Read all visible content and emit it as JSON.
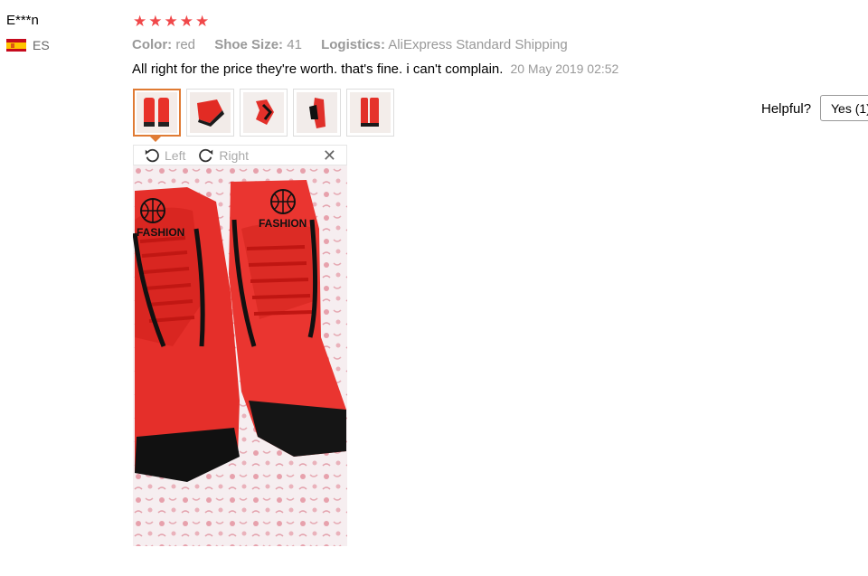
{
  "reviewer": {
    "name": "E***n",
    "country_code": "ES",
    "flag_icon": "spain-flag-icon"
  },
  "rating": {
    "stars": 5,
    "max": 5,
    "star_color": "#f0484a"
  },
  "attributes": [
    {
      "key": "Color:",
      "value": "red"
    },
    {
      "key": "Shoe Size:",
      "value": "41"
    },
    {
      "key": "Logistics:",
      "value": "AliExpress Standard Shipping"
    }
  ],
  "feedback": {
    "text": "All right for the price they're worth. that's fine. i can't complain.",
    "date": "20 May 2019 02:52"
  },
  "photos": {
    "count": 5,
    "selected_index": 0
  },
  "viewer": {
    "rotate_left_label": "Left",
    "rotate_right_label": "Right",
    "close_icon": "close-icon"
  },
  "image_text": {
    "logo_word": "FASHION"
  },
  "helpful": {
    "label": "Helpful?",
    "yes_label": "Yes (1)"
  },
  "colors": {
    "accent": "#e07b34",
    "muted": "#999999"
  }
}
